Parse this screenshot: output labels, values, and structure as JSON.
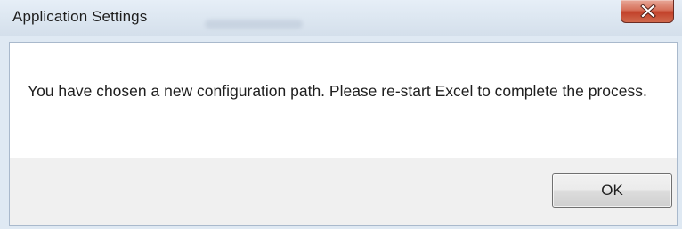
{
  "window": {
    "title": "Application Settings",
    "close_icon": "close-x-icon",
    "colors": {
      "frame": "#dfe9f3",
      "close_button": "#c2412a",
      "content_background": "#f0f0f0",
      "message_background": "#ffffff"
    }
  },
  "dialog": {
    "message": "You have chosen a new configuration path. Please re-start Excel to complete the process.",
    "ok_label": "OK"
  }
}
